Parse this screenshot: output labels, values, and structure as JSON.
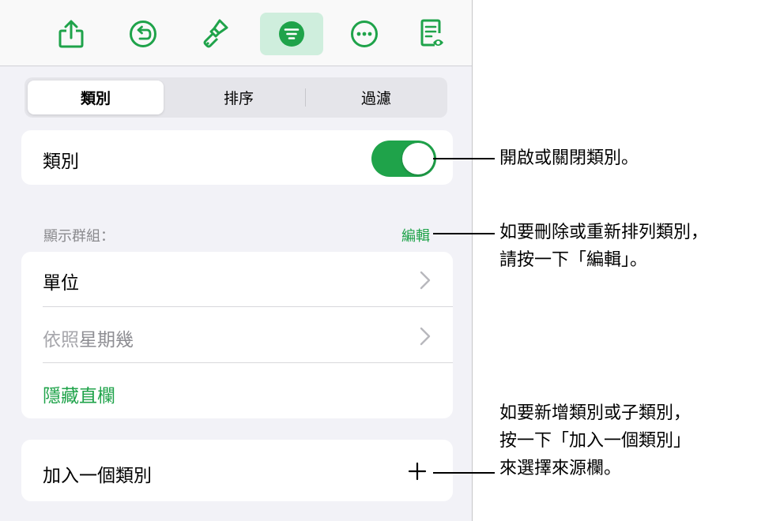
{
  "toolbar": {
    "buttons": [
      {
        "name": "share-icon",
        "active": false
      },
      {
        "name": "undo-icon",
        "active": false
      },
      {
        "name": "format-brush-icon",
        "active": false
      },
      {
        "name": "organize-icon",
        "active": true
      },
      {
        "name": "more-icon",
        "active": false
      },
      {
        "name": "reading-view-icon",
        "active": false
      }
    ]
  },
  "segmented": {
    "categories": "類別",
    "sort": "排序",
    "filter": "過濾",
    "selected": "類別"
  },
  "categories_toggle": {
    "label": "類別",
    "on": true
  },
  "groups": {
    "header": "顯示群組：",
    "edit": "編輯",
    "unit": "單位",
    "by_prefix": "依照",
    "by_value": "星期幾",
    "hide_columns": "隱藏直欄"
  },
  "add_category": {
    "label": "加入一個類別",
    "icon": "plus-icon"
  },
  "callouts": {
    "toggle": "開啟或關閉類別。",
    "edit_line1": "如要刪除或重新排列類別，",
    "edit_line2": "請按一下「編輯」。",
    "add_line1": "如要新增類別或子類別，",
    "add_line2": "按一下「加入一個類別」",
    "add_line3": "來選擇來源欄。"
  },
  "colors": {
    "accent": "#1fa34a",
    "active_tab_bg": "#cfeedd",
    "panel_bg": "#f2f2f7"
  }
}
